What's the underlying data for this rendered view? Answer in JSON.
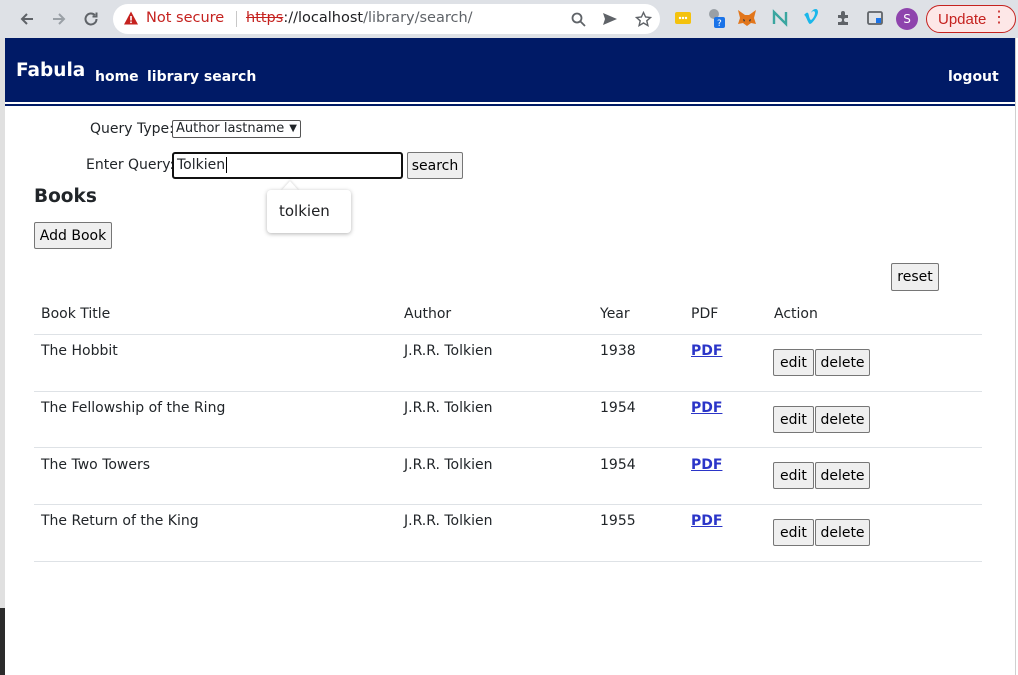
{
  "browser": {
    "security_label": "Not secure",
    "url_scheme": "https",
    "url_host": "://localhost",
    "url_path": "/library/search/",
    "update_label": "Update",
    "profile_initial": "S",
    "accent_color": "#c5221f"
  },
  "navbar": {
    "brand": "Fabula",
    "links": [
      "home",
      "library search"
    ],
    "logout": "logout",
    "background": "#001a66"
  },
  "form": {
    "query_type_label": "Query Type:",
    "query_type_value": "Author lastname",
    "query_label": "Enter Query:",
    "query_value": "Tolkien",
    "search_label": "search",
    "autocomplete_suggestion": "tolkien"
  },
  "books": {
    "title": "Books",
    "add_label": "Add Book",
    "reset_label": "reset",
    "headers": [
      "Book Title",
      "Author",
      "Year",
      "PDF",
      "Action"
    ],
    "rows": [
      {
        "title": "The Hobbit",
        "author": "J.R.R. Tolkien",
        "year": "1938",
        "pdf": "PDF",
        "edit": "edit",
        "delete": "delete"
      },
      {
        "title": "The Fellowship of the Ring",
        "author": "J.R.R. Tolkien",
        "year": "1954",
        "pdf": "PDF",
        "edit": "edit",
        "delete": "delete"
      },
      {
        "title": "The Two Towers",
        "author": "J.R.R. Tolkien",
        "year": "1954",
        "pdf": "PDF",
        "edit": "edit",
        "delete": "delete"
      },
      {
        "title": "The Return of the King",
        "author": "J.R.R. Tolkien",
        "year": "1955",
        "pdf": "PDF",
        "edit": "edit",
        "delete": "delete"
      }
    ]
  }
}
